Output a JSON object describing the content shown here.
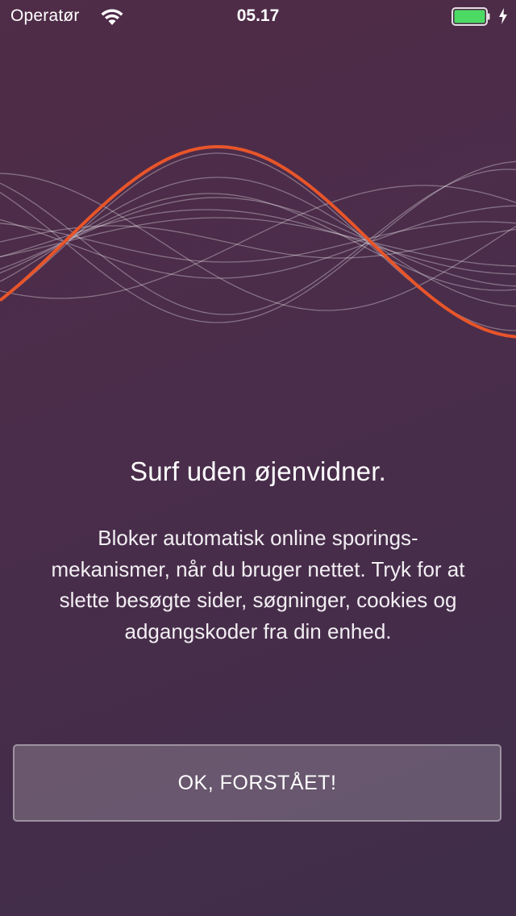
{
  "status_bar": {
    "carrier": "Operatør",
    "time": "05.17",
    "icons": [
      "wifi-icon",
      "battery-icon",
      "charging-bolt-icon"
    ]
  },
  "colors": {
    "accent_wave": "#e8552a",
    "background_top": "#4f2c47",
    "background_bottom": "#3f2d49",
    "battery_fill": "#4cd964"
  },
  "hero": {
    "icon": "sound-waves-illustration"
  },
  "onboarding": {
    "title": "Surf uden øjenvidner.",
    "description_lines": [
      "Bloker automatisk online sporings-",
      "mekanismer, når du bruger nettet. Tryk for at",
      "slette besøgte sider, søgninger, cookies og",
      "adgangskoder fra din enhed."
    ],
    "button_label": "OK, FORSTÅET!"
  }
}
